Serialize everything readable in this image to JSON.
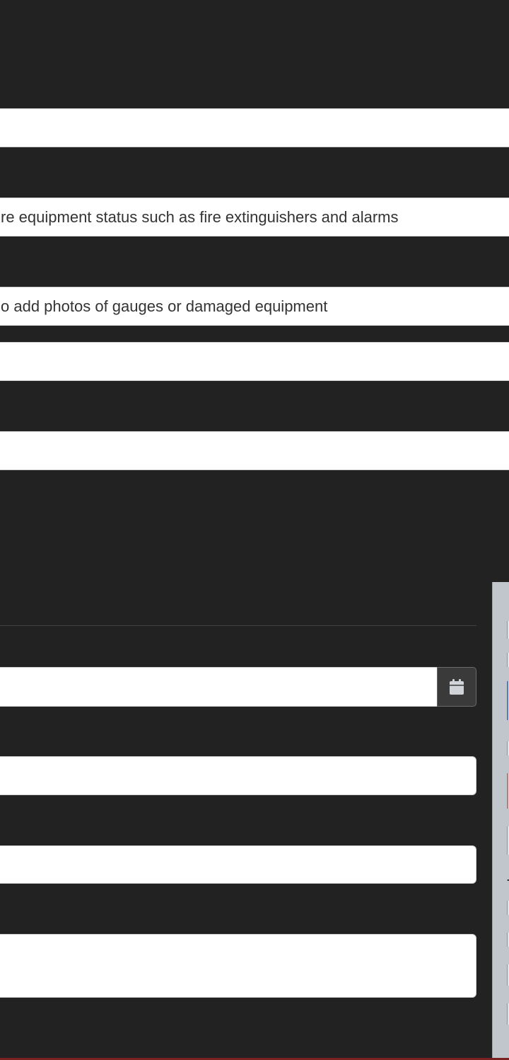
{
  "form": {
    "fields": [
      {
        "value": ""
      },
      {
        "value": "re equipment status such as fire extinguishers and alarms"
      },
      {
        "value": "o add photos of gauges or damaged equipment"
      },
      {
        "value": ""
      },
      {
        "value": ""
      }
    ]
  },
  "lower_form": {
    "date_value": "",
    "field_a": "",
    "field_b": "",
    "notes": ""
  },
  "icons": {
    "calendar": "calendar-icon"
  },
  "colors": {
    "background": "#222222",
    "field": "#ffffff",
    "calendar_button": "#3a3a3a",
    "side_panel": "#c0c6cc",
    "bottom_accent": "#7a2222"
  }
}
